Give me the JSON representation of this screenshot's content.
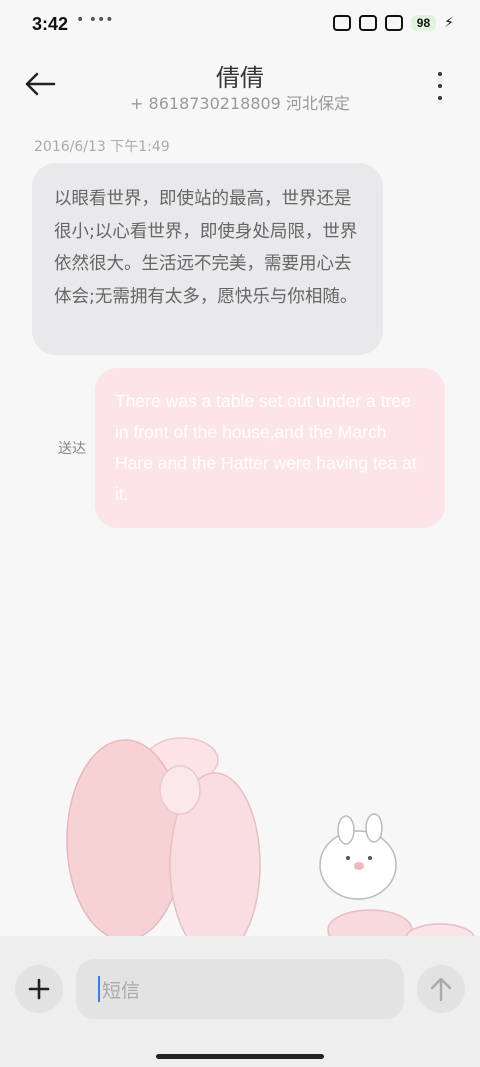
{
  "status_bar": {
    "time": "3:42",
    "dots": "• •••",
    "battery": "98"
  },
  "header": {
    "contact_name": "倩倩",
    "contact_number": "+ 8618730218809 河北保定"
  },
  "conversation": {
    "timestamp": "2016/6/13 下午1:49",
    "messages": [
      {
        "direction": "incoming",
        "text": "以眼看世界，即使站的最高，世界还是很小;以心看世界，即使身处局限，世界依然很大。生活远不完美，需要用心去体会;无需拥有太多，愿快乐与你相随。"
      },
      {
        "direction": "outgoing",
        "status": "送达",
        "text": "There was a table set out under a tree in front of the house,and the March Hare and the Hatter were having tea at it."
      }
    ]
  },
  "composer": {
    "placeholder": "短信"
  },
  "colors": {
    "incoming_bubble": "#e9e8ea",
    "outgoing_bubble": "#fde4e8",
    "cursor": "#3a7bf2"
  },
  "icons": [
    "back-arrow-icon",
    "more-vert-icon",
    "plus-icon",
    "send-arrow-icon"
  ]
}
